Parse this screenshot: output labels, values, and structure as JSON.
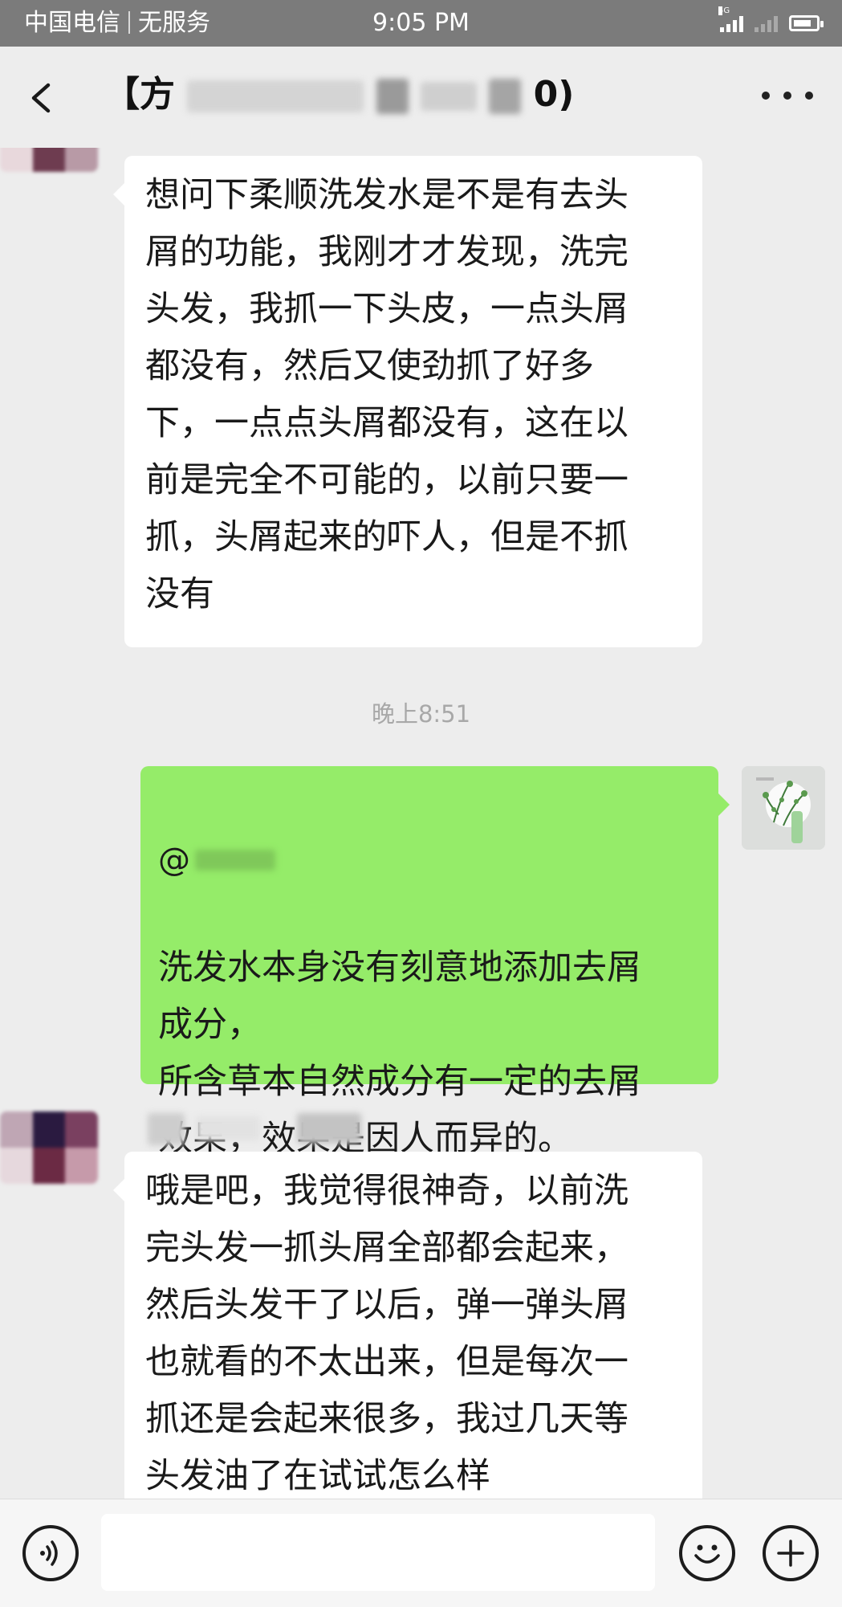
{
  "status_bar": {
    "carrier": "中国电信",
    "service": "无服务",
    "time": "9:05 PM",
    "network": "4G",
    "battery_level": 0.8
  },
  "nav": {
    "title_prefix": "【方",
    "title_suffix": "0)",
    "back_icon": "chevron-left-icon",
    "more_icon": "more-horizontal-icon"
  },
  "messages": {
    "msg1": "想问下柔顺洗发水是不是有去头\n屑的功能，我刚才才发现，洗完\n头发，我抓一下头皮，一点头屑\n都没有，然后又使劲抓了好多\n下，一点点头屑都没有，这在以\n前是完全不可能的，以前只要一\n抓，头屑起来的吓人，但是不抓\n没有",
    "timestamp": "晚上8:51",
    "msg2_mention": "@",
    "msg2": "洗发水本身没有刻意地添加去屑\n成分，\n所含草本自然成分有一定的去屑\n效果，效果是因人而异的。",
    "msg3": "哦是吧，我觉得很神奇，以前洗\n完头发一抓头屑全部都会起来，\n然后头发干了以后，弹一弹头屑\n也就看的不太出来，但是每次一\n抓还是会起来很多，我过几天等\n头发油了在试试怎么样"
  },
  "input_bar": {
    "voice_icon": "voice-icon",
    "emoji_icon": "emoji-icon",
    "plus_icon": "plus-icon",
    "input_value": ""
  },
  "colors": {
    "status_bg": "#7b7b7b",
    "chat_bg": "#ededed",
    "sent_bubble": "#95ec69",
    "received_bubble": "#ffffff"
  }
}
